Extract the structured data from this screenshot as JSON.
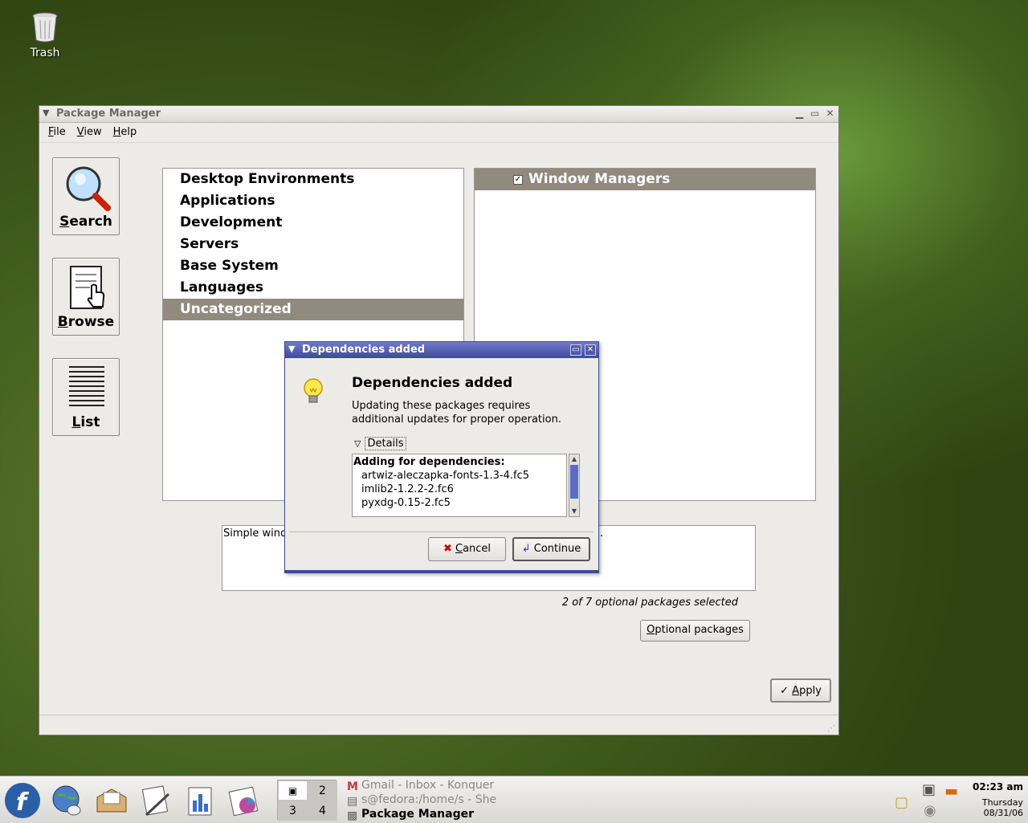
{
  "desktop": {
    "trash_label": "Trash"
  },
  "main_window": {
    "title": "Package Manager",
    "menu": [
      {
        "label": "File",
        "mnemonic": "F",
        "rest": "ile"
      },
      {
        "label": "View",
        "mnemonic": "V",
        "rest": "iew"
      },
      {
        "label": "Help",
        "mnemonic": "H",
        "rest": "elp"
      }
    ],
    "sidebar": {
      "search": {
        "mnemonic": "S",
        "rest": "earch"
      },
      "browse": {
        "mnemonic": "B",
        "rest": "rowse"
      },
      "list": {
        "mnemonic": "L",
        "rest": "ist"
      }
    },
    "categories": [
      "Desktop Environments",
      "Applications",
      "Development",
      "Servers",
      "Base System",
      "Languages",
      "Uncategorized"
    ],
    "selected_category": "Uncategorized",
    "groups": {
      "header": "Window Managers",
      "checked": true
    },
    "description_visible": "Simple wind",
    "description_tail": ".",
    "optional_status": "2 of 7 optional packages selected",
    "optional_button": {
      "mnemonic": "O",
      "rest": "ptional packages"
    },
    "apply_button": {
      "mnemonic": "A",
      "rest": "pply"
    }
  },
  "dialog": {
    "title": "Dependencies added",
    "heading": "Dependencies added",
    "body": "Updating these packages requires additional updates for proper operation.",
    "details_label": "Details",
    "details_expanded": true,
    "deps_header": "Adding for dependencies:",
    "deps": [
      "artwiz-aleczapka-fonts-1.3-4.fc5",
      "imlib2-1.2.2-2.fc6",
      "pyxdg-0.15-2.fc5"
    ],
    "cancel_button": {
      "mnemonic": "C",
      "rest": "ancel"
    },
    "continue_button": "Continue"
  },
  "taskbar": {
    "pager": {
      "ws1": "",
      "ws2": "2",
      "ws3": "3",
      "ws4": "4"
    },
    "tasks": [
      "Gmail - Inbox - Konquer",
      "s@fedora:/home/s - She",
      "Package Manager"
    ],
    "clock": {
      "time": "02:23 am",
      "day": "Thursday",
      "date": "08/31/06"
    }
  },
  "colors": {
    "selection": "#918a7f",
    "dialog_titlebar": "#3e4a98",
    "window_bg": "#edebe7"
  }
}
